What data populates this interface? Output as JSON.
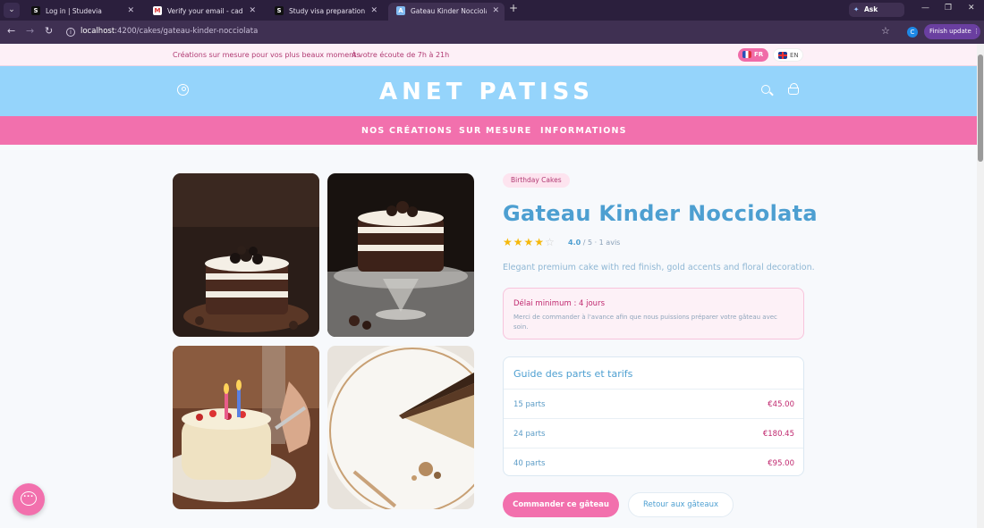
{
  "browser": {
    "tabs": [
      {
        "favicon": "S",
        "title": "Log in | Studevia"
      },
      {
        "favicon": "M",
        "title": "Verify your email - cadalevansd"
      },
      {
        "favicon": "S",
        "title": "Study visa preparation and em"
      },
      {
        "favicon": "A",
        "title": "Gateau Kinder Nocciolata | Gât"
      }
    ],
    "new_tab": "+",
    "gemini_label": "Ask Gemini",
    "url_host": "localhost",
    "url_path": ":4200/cakes/gateau-kinder-nocciolata",
    "profile_initial": "C",
    "finish_update": "Finish update"
  },
  "topstrip": {
    "promo1": "Créations sur mesure pour vos plus beaux moments",
    "promo2": "À votre écoute de 7h à 21h",
    "lang_fr": "FR",
    "lang_en": "EN"
  },
  "header": {
    "logo": "ANET PATISS"
  },
  "nav": {
    "items": [
      "NOS CRÉATIONS",
      "SUR MESURE",
      "INFORMATIONS"
    ]
  },
  "product": {
    "category": "Birthday Cakes",
    "title": "Gateau Kinder Nocciolata",
    "rating_value": "4.0",
    "rating_rest": " / 5 · 1 avis",
    "rating_stars": 4,
    "description": "Elegant premium cake with red finish, gold accents and floral decoration.",
    "notice_title": "Délai minimum : 4 jours",
    "notice_text": "Merci de commander à l'avance afin que nous puissions préparer votre gâteau avec soin.",
    "guide_title": "Guide des parts et tarifs",
    "guide_rows": [
      {
        "label": "15 parts",
        "price": "€45.00"
      },
      {
        "label": "24 parts",
        "price": "€180.45"
      },
      {
        "label": "40 parts",
        "price": "€95.00"
      }
    ],
    "order_button": "Commander ce gâteau",
    "back_button": "Retour aux gâteaux"
  },
  "colors": {
    "header_blue": "#95d4fb",
    "nav_pink": "#f270ad",
    "title_blue": "#4d9fd1",
    "price_magenta": "#c0296f"
  }
}
